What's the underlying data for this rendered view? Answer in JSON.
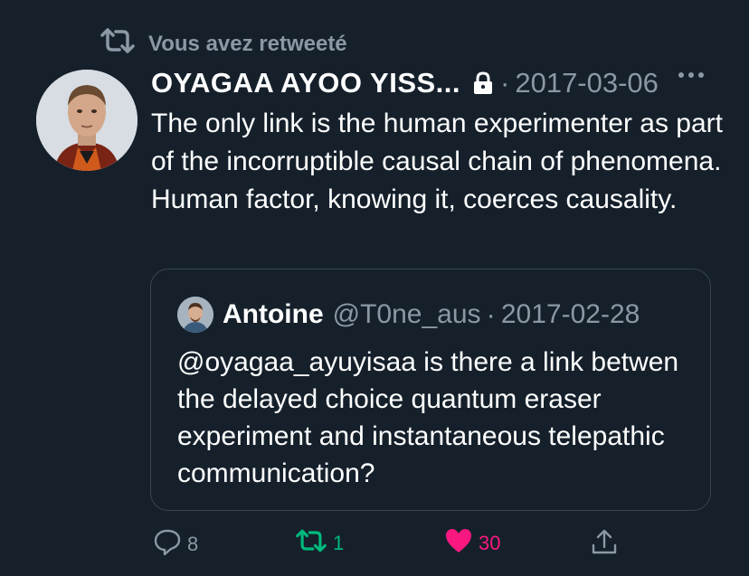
{
  "retweet_header": {
    "text": "Vous avez retweeté"
  },
  "tweet": {
    "author_name": "OYAGAA AYOO YISS...",
    "date": "2017-03-06",
    "text": "The only link is the human experimenter as part of the incorruptible causal chain of phenomena. Human factor, knowing it, coerces causality."
  },
  "quote": {
    "name": "Antoine",
    "handle": "@T0ne_aus",
    "date": "2017-02-28",
    "text": "@oyagaa_ayuyisaa is there a link betwen the delayed choice quantum eraser experiment and instantaneous telepathic communication?"
  },
  "actions": {
    "replies": "8",
    "retweets": "1",
    "likes": "30"
  },
  "colors": {
    "background": "#15202b",
    "secondary_text": "#8b98a5",
    "retweet_green": "#00ba7c",
    "like_pink": "#f91880",
    "border": "#38444d"
  },
  "icons": [
    "retweet-icon",
    "lock-icon",
    "more-icon",
    "reply-icon",
    "heart-icon",
    "share-icon"
  ]
}
